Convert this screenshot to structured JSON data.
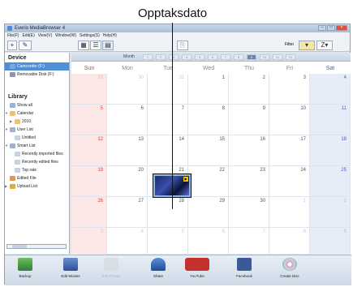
{
  "callout": {
    "label": "Opptaksdato"
  },
  "window": {
    "title": "Everio MediaBrowser 4",
    "menu": [
      "File(F)",
      "Edit(E)",
      "View(V)",
      "Window(W)",
      "Settings(S)",
      "Help(H)"
    ],
    "filter_label": "Filter"
  },
  "sidebar": {
    "device_header": "Device",
    "devices": [
      {
        "label": "Camcorder (F:)",
        "selected": true
      },
      {
        "label": "Removable Disk (F:)",
        "selected": false
      }
    ],
    "library_header": "Library",
    "items": [
      {
        "label": "Show all",
        "level": 0
      },
      {
        "label": "Calendar",
        "level": 0
      },
      {
        "label": "2010",
        "level": 1
      },
      {
        "label": "User List",
        "level": 0
      },
      {
        "label": "Untitled",
        "level": 1
      },
      {
        "label": "Smart List",
        "level": 0
      },
      {
        "label": "Recently imported files",
        "level": 1
      },
      {
        "label": "Recently edited files",
        "level": 1
      },
      {
        "label": "Top rate",
        "level": 1
      },
      {
        "label": "Edited File",
        "level": 0
      },
      {
        "label": "Upload List",
        "level": 0
      }
    ]
  },
  "calendar": {
    "month_label": "Month",
    "months": [
      "1",
      "2",
      "3",
      "4",
      "5",
      "6",
      "7",
      "8",
      "9",
      "10",
      "11",
      "12"
    ],
    "current_month_index": 8,
    "weekday_headers": [
      "Sun",
      "Mon",
      "Tue",
      "Wed",
      "Thu",
      "Fri",
      "Sat"
    ],
    "weeks": [
      [
        "29",
        "30",
        "31",
        "1",
        "2",
        "3",
        "4"
      ],
      [
        "5",
        "6",
        "7",
        "8",
        "9",
        "10",
        "11"
      ],
      [
        "12",
        "13",
        "14",
        "15",
        "16",
        "17",
        "18"
      ],
      [
        "19",
        "20",
        "21",
        "22",
        "23",
        "24",
        "25"
      ],
      [
        "26",
        "27",
        "28",
        "29",
        "30",
        "1",
        "2"
      ],
      [
        "3",
        "4",
        "5",
        "6",
        "7",
        "8",
        "9"
      ]
    ],
    "dim_cells": [
      [
        0,
        0
      ],
      [
        0,
        1
      ],
      [
        0,
        2
      ],
      [
        4,
        5
      ],
      [
        4,
        6
      ],
      [
        5,
        0
      ],
      [
        5,
        1
      ],
      [
        5,
        2
      ],
      [
        5,
        3
      ],
      [
        5,
        4
      ],
      [
        5,
        5
      ],
      [
        5,
        6
      ]
    ]
  },
  "bottom": {
    "items": [
      {
        "label": "Backup",
        "icon": "backup-icon",
        "enabled": true
      },
      {
        "label": "Edit Movies",
        "icon": "edit-movies-icon",
        "enabled": true
      },
      {
        "label": "Edit Photos",
        "icon": "edit-photos-icon",
        "enabled": false
      },
      {
        "label": "Share",
        "icon": "share-icon",
        "enabled": true
      },
      {
        "label": "YouTube",
        "icon": "youtube-icon",
        "enabled": true
      },
      {
        "label": "Facebook",
        "icon": "facebook-icon",
        "enabled": true
      },
      {
        "label": "Create Disc",
        "icon": "create-disc-icon",
        "enabled": true
      }
    ]
  }
}
